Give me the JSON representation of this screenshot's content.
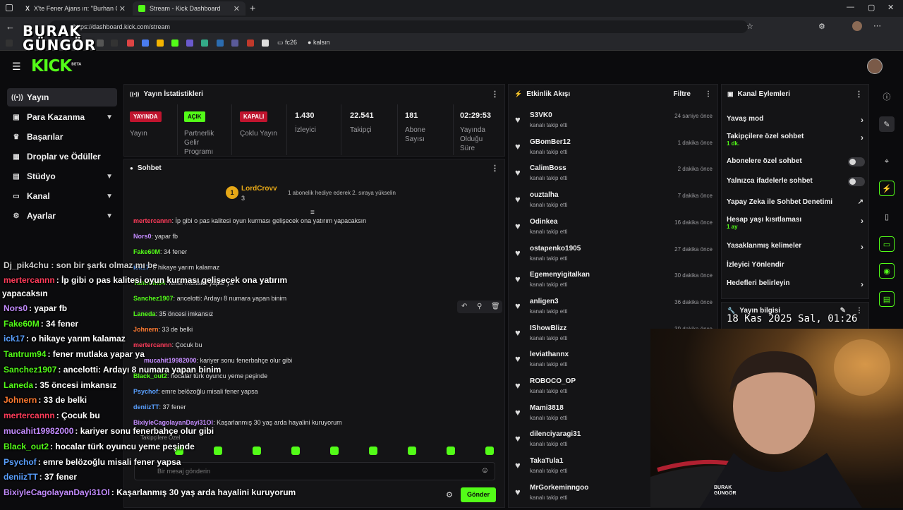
{
  "browser": {
    "tabs": [
      {
        "title": "X'te Fener Ajans ın: \"Burhan Can"
      },
      {
        "title": "Stream - Kick Dashboard"
      }
    ],
    "url": "https://dashboard.kick.com/stream",
    "bookmarks": [
      "fc26",
      "kalsın"
    ]
  },
  "watermark": {
    "line1": "BURAK",
    "line2": "GÜNGÖR"
  },
  "logo": "KICK",
  "logo_tag": "BETA",
  "sidebar": {
    "items": [
      {
        "label": "Yayın",
        "icon": "broadcast-icon"
      },
      {
        "label": "Para Kazanma",
        "icon": "wallet-icon"
      },
      {
        "label": "Başarılar",
        "icon": "trophy-icon"
      },
      {
        "label": "Droplar ve Ödüller",
        "icon": "gift-icon"
      },
      {
        "label": "Stüdyo",
        "icon": "grid-icon"
      },
      {
        "label": "Kanal",
        "icon": "tv-icon"
      },
      {
        "label": "Ayarlar",
        "icon": "gear-icon"
      }
    ]
  },
  "stats": {
    "title": "Yayın İstatistikleri",
    "cells": [
      {
        "badge": "YAYINDA",
        "label": "Yayın",
        "color": "#ff3c5a"
      },
      {
        "badge": "AÇIK",
        "label": "Partnerlik Gelir Programı",
        "color": "#53fc18"
      },
      {
        "badge": "KAPALI",
        "label": "Çoklu Yayın",
        "color": "#ff3c5a"
      },
      {
        "value": "1.430",
        "label": "İzleyici"
      },
      {
        "value": "22.541",
        "label": "Takipçi"
      },
      {
        "value": "181",
        "label": "Abone Sayısı"
      },
      {
        "value": "02:29:53",
        "label": "Yayında Olduğu Süre"
      }
    ]
  },
  "chat": {
    "title": "Sohbet",
    "pinned_user": "LordCrovv",
    "pinned_level": "1",
    "pinned_count": "3",
    "pinned_msg": "1 abonelik hediye ederek 2. sıraya yükselin",
    "messages": [
      {
        "user": "mertercannn",
        "text": "İp gibi o pas kalitesi oyun kurması gelişecek ona yatırım yapacaksın",
        "color": "#ff3c5a"
      },
      {
        "user": "Nors0",
        "text": "yapar fb",
        "color": "#c48cff"
      },
      {
        "user": "Fake60M",
        "text": "34 fener",
        "color": "#53fc18"
      },
      {
        "user": "ick17",
        "text": "o hikaye yarım kalamaz",
        "color": "#5aa0ff"
      },
      {
        "user": "Tantrum94",
        "text": "fener mutlaka yapar ya",
        "color": "#53fc18"
      },
      {
        "user": "Sanchez1907",
        "text": "ancelotti: Ardayı 8 numara yapan binim",
        "color": "#53fc18"
      },
      {
        "user": "Laneda",
        "text": "35 öncesi imkansız",
        "color": "#53fc18"
      },
      {
        "user": "Johnern",
        "text": "33 de belki",
        "color": "#ff7a30"
      },
      {
        "user": "mertercannn",
        "text": "Çocuk bu",
        "color": "#ff3c5a"
      },
      {
        "user": "mucahit19982000",
        "text": "kariyer sonu fenerbahçe olur gibi",
        "color": "#c48cff"
      },
      {
        "user": "Black_out2",
        "text": "hocalar türk oyuncu yeme peşinde",
        "color": "#53fc18"
      },
      {
        "user": "Psychof",
        "text": "emre belözoğlu misali fener yapsa",
        "color": "#5aa0ff"
      },
      {
        "user": "deniizTT",
        "text": "37 fener",
        "color": "#5aa0ff"
      },
      {
        "user": "BixiyleCagolayanDayi31Ol",
        "text": "Kaşarlanmış 30 yaş arda hayalini kuruyorum",
        "color": "#c48cff"
      }
    ],
    "followers_only": "Takipçilere Özel",
    "input_placeholder": "Bir mesaj gönderin",
    "send": "Gönder"
  },
  "overlay": {
    "first": "Dj_pik4chu : son bir şarkı olmaz mı be",
    "lines": [
      {
        "user": "mertercannn",
        "text": ": İp gibi o pas kalitesi oyun kurması gelişecek ona yatırım"
      },
      {
        "user": "",
        "text": "yapacaksın"
      },
      {
        "user": "Nors0",
        "text": ": yapar fb"
      },
      {
        "user": "Fake60M",
        "text": ": 34 fener"
      },
      {
        "user": "ick17",
        "text": ": o hikaye yarım kalamaz"
      },
      {
        "user": "Tantrum94",
        "text": ": fener mutlaka yapar ya"
      },
      {
        "user": "Sanchez1907",
        "text": ": ancelotti: Ardayı 8 numara yapan binim"
      },
      {
        "user": "Laneda",
        "text": ": 35 öncesi imkansız"
      },
      {
        "user": "Johnern",
        "text": ": 33 de belki"
      },
      {
        "user": "mertercannn",
        "text": ": Çocuk bu"
      },
      {
        "user": "mucahit19982000",
        "text": ": kariyer sonu fenerbahçe olur gibi"
      },
      {
        "user": "Black_out2",
        "text": ": hocalar türk oyuncu yeme peşinde"
      },
      {
        "user": "Psychof",
        "text": ": emre belözoğlu misali fener yapsa"
      },
      {
        "user": "deniizTT",
        "text": ": 37 fener"
      },
      {
        "user": "BixiyleCagolayanDayi31Ol",
        "text": ": Kaşarlanmış 30 yaş arda hayalini kuruyorum"
      }
    ]
  },
  "events": {
    "title": "Etkinlik Akışı",
    "filter": "Filtre",
    "sub": "kanalı takip etti",
    "items": [
      {
        "name": "S3VK0",
        "time": "24 saniye önce"
      },
      {
        "name": "GBomBer12",
        "time": "1 dakika önce"
      },
      {
        "name": "CalimBoss",
        "time": "2 dakika önce"
      },
      {
        "name": "ouztalha",
        "time": "7 dakika önce"
      },
      {
        "name": "Odinkea",
        "time": "16 dakika önce"
      },
      {
        "name": "ostapenko1905",
        "time": "27 dakika önce"
      },
      {
        "name": "Egemenyigitalkan",
        "time": "30 dakika önce"
      },
      {
        "name": "anligen3",
        "time": "36 dakika önce"
      },
      {
        "name": "IShowBlizz",
        "time": "39 dakika önce"
      },
      {
        "name": "leviathannx",
        "time": ""
      },
      {
        "name": "ROBOCO_OP",
        "time": ""
      },
      {
        "name": "Mami3818",
        "time": ""
      },
      {
        "name": "dilenciyaragi31",
        "time": ""
      },
      {
        "name": "TakaTula1",
        "time": ""
      },
      {
        "name": "MrGorkeminngoo",
        "time": ""
      }
    ]
  },
  "channel": {
    "title": "Kanal Eylemleri",
    "actions": [
      {
        "label": "Yavaş mod",
        "kind": "arrow",
        "sub": ""
      },
      {
        "label": "Takipçilere özel sohbet",
        "kind": "arrow",
        "sub": "1 dk."
      },
      {
        "label": "Abonelere özel sohbet",
        "kind": "toggle",
        "sub": ""
      },
      {
        "label": "Yalnızca ifadelerle sohbet",
        "kind": "toggle",
        "sub": ""
      },
      {
        "label": "Yapay Zeka ile Sohbet Denetimi",
        "kind": "ext",
        "sub": ""
      },
      {
        "label": "Hesap yaşı kısıtlaması",
        "kind": "arrow",
        "sub": "1 ay"
      },
      {
        "label": "Yasaklanmış kelimeler",
        "kind": "arrow",
        "sub": ""
      },
      {
        "label": "İzleyici Yönlendir",
        "kind": "none",
        "sub": ""
      },
      {
        "label": "Hedefleri belirleyin",
        "kind": "arrow",
        "sub": ""
      }
    ],
    "info_title": "Yayın bilgisi",
    "clock": "18 Kas 2025 Sal, 01:26"
  },
  "webcam_tag": "BURAK GÜNGÖR"
}
